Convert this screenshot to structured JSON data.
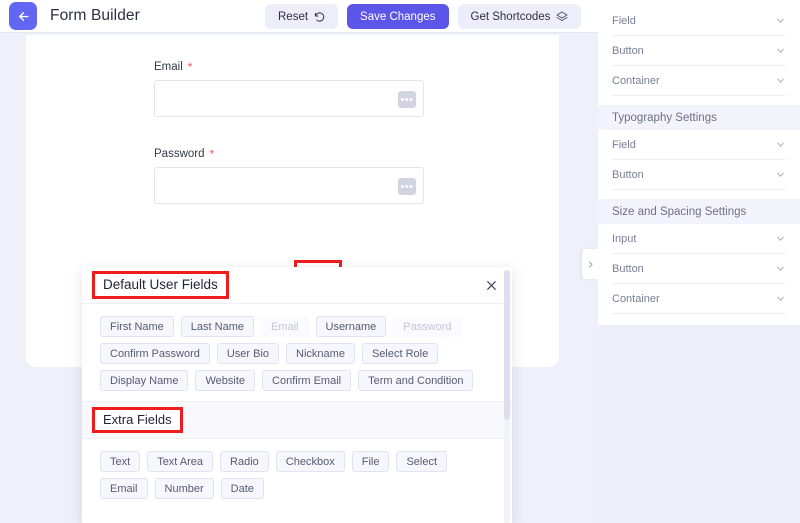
{
  "header": {
    "title": "Form Builder",
    "back_icon": "arrow-left-icon",
    "buttons": [
      {
        "label": "Reset",
        "icon": "undo-icon",
        "variant": "light"
      },
      {
        "label": "Save Changes",
        "icon": "",
        "variant": "primary"
      },
      {
        "label": "Get Shortcodes",
        "icon": "layers-icon",
        "variant": "light"
      }
    ]
  },
  "form": {
    "fields": [
      {
        "label": "Email",
        "required": "*",
        "value": "",
        "menu_icon": "ellipsis-icon"
      },
      {
        "label": "Password",
        "required": "*",
        "value": "",
        "menu_icon": "ellipsis-icon"
      }
    ],
    "add_button_icon": "plus-icon"
  },
  "settings_panel": {
    "toggle_icon": "chevron-right-icon",
    "sections": [
      {
        "title": "",
        "rows": [
          {
            "label": "Field",
            "icon": "chevron-down-icon"
          },
          {
            "label": "Button",
            "icon": "chevron-down-icon"
          },
          {
            "label": "Container",
            "icon": "chevron-down-icon"
          }
        ]
      },
      {
        "title": "Typography Settings",
        "rows": [
          {
            "label": "Field",
            "icon": "chevron-down-icon"
          },
          {
            "label": "Button",
            "icon": "chevron-down-icon"
          }
        ]
      },
      {
        "title": "Size and Spacing Settings",
        "rows": [
          {
            "label": "Input",
            "icon": "chevron-down-icon"
          },
          {
            "label": "Button",
            "icon": "chevron-down-icon"
          },
          {
            "label": "Container",
            "icon": "chevron-down-icon"
          }
        ]
      }
    ]
  },
  "modal": {
    "title": "Default User Fields",
    "close_icon": "close-icon",
    "default_fields": [
      {
        "label": "First Name",
        "disabled": false
      },
      {
        "label": "Last Name",
        "disabled": false
      },
      {
        "label": "Email",
        "disabled": true
      },
      {
        "label": "Username",
        "disabled": false
      },
      {
        "label": "Password",
        "disabled": true
      },
      {
        "label": "Confirm Password",
        "disabled": false
      },
      {
        "label": "User Bio",
        "disabled": false
      },
      {
        "label": "Nickname",
        "disabled": false
      },
      {
        "label": "Select Role",
        "disabled": false
      },
      {
        "label": "Display Name",
        "disabled": false
      },
      {
        "label": "Website",
        "disabled": false
      },
      {
        "label": "Confirm Email",
        "disabled": false
      },
      {
        "label": "Term and Condition",
        "disabled": false
      }
    ],
    "extra_title": "Extra Fields",
    "extra_fields": [
      {
        "label": "Text",
        "disabled": false
      },
      {
        "label": "Text Area",
        "disabled": false
      },
      {
        "label": "Radio",
        "disabled": false
      },
      {
        "label": "Checkbox",
        "disabled": false
      },
      {
        "label": "File",
        "disabled": false
      },
      {
        "label": "Select",
        "disabled": false
      },
      {
        "label": "Email",
        "disabled": false
      },
      {
        "label": "Number",
        "disabled": false
      },
      {
        "label": "Date",
        "disabled": false
      }
    ]
  },
  "colors": {
    "brand": "#5b55e8",
    "accent": "#6366f1",
    "highlight": "#ee1c1c",
    "required": "#f2564d",
    "page_bg": "#f0f0fa"
  }
}
